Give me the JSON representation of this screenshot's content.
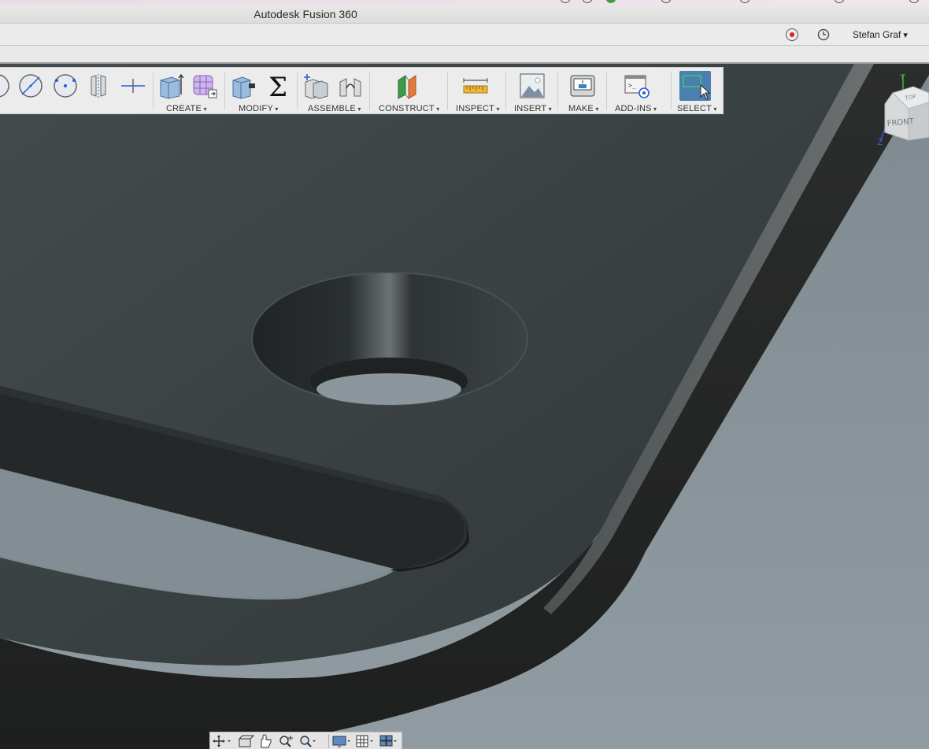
{
  "window": {
    "title": "Autodesk Fusion 360"
  },
  "account": {
    "user_name": "Stefan Graf",
    "record_icon": "record-icon",
    "history_icon": "clock-icon"
  },
  "toolbar": {
    "sketch_tools": [
      "circle-slash-icon",
      "circle-center-icon",
      "mirror-icon",
      "project-line-icon"
    ],
    "groups": [
      {
        "label": "CREATE",
        "icons": [
          "extrude-box-icon",
          "form-cube-icon"
        ]
      },
      {
        "label": "MODIFY",
        "icons": [
          "press-pull-icon",
          "sigma-icon"
        ]
      },
      {
        "label": "ASSEMBLE",
        "icons": [
          "new-component-icon",
          "joint-icon"
        ]
      },
      {
        "label": "CONSTRUCT",
        "icons": [
          "plane-icon"
        ]
      },
      {
        "label": "INSPECT",
        "icons": [
          "measure-ruler-icon"
        ]
      },
      {
        "label": "INSERT",
        "icons": [
          "image-icon"
        ]
      },
      {
        "label": "MAKE",
        "icons": [
          "print-icon"
        ]
      },
      {
        "label": "ADD-INS",
        "icons": [
          "scripts-gear-icon"
        ]
      },
      {
        "label": "SELECT",
        "icons": [
          "select-window-icon"
        ]
      }
    ]
  },
  "viewcube": {
    "front_label": "FRONT",
    "top_label": "TOP",
    "axis_y": "Y",
    "axis_z": "Z"
  },
  "navbar": {
    "buttons": [
      "orbit-icon",
      "look-at-icon",
      "pan-hand-icon",
      "zoom-icon",
      "fit-icon",
      "display-settings-icon",
      "grid-icon",
      "viewports-icon"
    ]
  },
  "colors": {
    "part_top": "#3b4243",
    "part_side": "#2a2c2c",
    "background": "#8a969c",
    "accent_select": "#4a7fb0"
  }
}
